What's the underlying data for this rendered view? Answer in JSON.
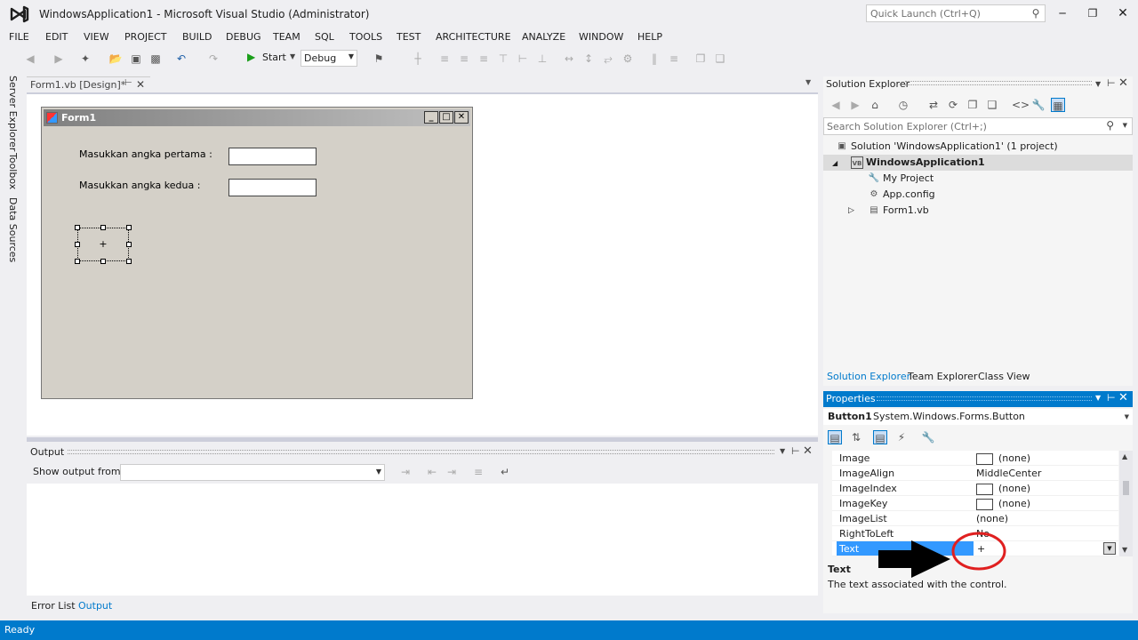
{
  "window": {
    "title": "WindowsApplication1 - Microsoft Visual Studio (Administrator)"
  },
  "quick_launch": {
    "placeholder": "Quick Launch (Ctrl+Q)"
  },
  "menu": [
    "FILE",
    "EDIT",
    "VIEW",
    "PROJECT",
    "BUILD",
    "DEBUG",
    "TEAM",
    "SQL",
    "TOOLS",
    "TEST",
    "ARCHITECTURE",
    "ANALYZE",
    "WINDOW",
    "HELP"
  ],
  "toolbar": {
    "start_label": "Start",
    "config_value": "Debug"
  },
  "left_tabs": [
    "Server Explorer",
    "Toolbox",
    "Data Sources"
  ],
  "doc_tab": {
    "label": "Form1.vb [Design]*"
  },
  "form": {
    "title": "Form1",
    "label1": "Masukkan angka pertama :",
    "label2": "Masukkan angka kedua :",
    "button_text": "+"
  },
  "output": {
    "title": "Output",
    "show_from": "Show output from:",
    "combo_value": ""
  },
  "bottom_tabs": [
    "Error List",
    "Output"
  ],
  "solution_explorer": {
    "title": "Solution Explorer",
    "search_placeholder": "Search Solution Explorer (Ctrl+;)",
    "tree": [
      {
        "label": "Solution 'WindowsApplication1' (1 project)",
        "icon": "solution-icon"
      },
      {
        "label": "WindowsApplication1",
        "icon": "vb-project-icon"
      },
      {
        "label": "My Project",
        "icon": "wrench-icon"
      },
      {
        "label": "App.config",
        "icon": "config-file-icon"
      },
      {
        "label": "Form1.vb",
        "icon": "form-file-icon"
      }
    ],
    "tabs": [
      "Solution Explorer",
      "Team Explorer",
      "Class View"
    ]
  },
  "properties": {
    "title": "Properties",
    "object_name": "Button1",
    "object_type": "System.Windows.Forms.Button",
    "rows": [
      {
        "name": "Image",
        "value": "(none)",
        "swatch": true
      },
      {
        "name": "ImageAlign",
        "value": "MiddleCenter",
        "swatch": false
      },
      {
        "name": "ImageIndex",
        "value": "(none)",
        "swatch": true
      },
      {
        "name": "ImageKey",
        "value": "(none)",
        "swatch": true
      },
      {
        "name": "ImageList",
        "value": "(none)",
        "swatch": false
      },
      {
        "name": "RightToLeft",
        "value": "No",
        "swatch": false
      },
      {
        "name": "Text",
        "value": "+",
        "swatch": false
      }
    ],
    "desc_title": "Text",
    "desc_text": "The text associated with the control."
  },
  "status": {
    "text": "Ready"
  },
  "colors": {
    "accent": "#007acc",
    "selection": "#3399ff",
    "annotation_circle": "#e02020",
    "annotation_arrow": "#000000"
  }
}
